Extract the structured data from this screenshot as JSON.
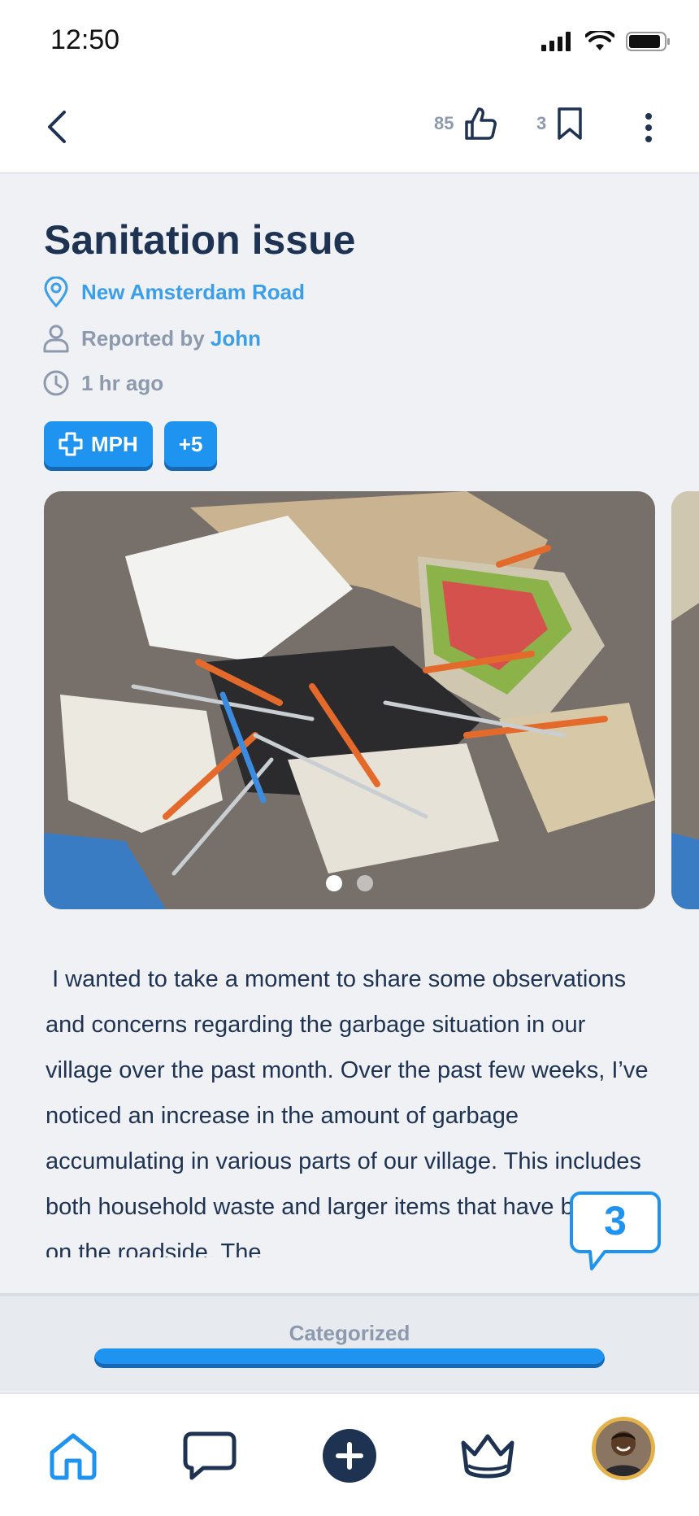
{
  "status_bar": {
    "time": "12:50"
  },
  "header": {
    "likes_count": "85",
    "bookmarks_count": "3"
  },
  "issue": {
    "title": "Sanitation issue",
    "location": "New Amsterdam Road",
    "reported_by_prefix": "Reported by",
    "reporter": "John",
    "time_ago": "1 hr ago",
    "tags": [
      {
        "label": "MPH",
        "icon": "plus-cross-icon"
      },
      {
        "label": "+5"
      }
    ],
    "images_count": 2,
    "active_image_index": 0,
    "description": " I wanted to take a moment to share some observations and concerns regarding the garbage situation in our village over the past month. Over the past few weeks, I’ve noticed an increase in the amount of garbage accumulating in various parts of our village. This includes both household waste and larger items that have been left on the roadside. The"
  },
  "comments": {
    "count": "3"
  },
  "progress": {
    "label": "Categorized",
    "value": 1.0
  },
  "nav": {
    "items": [
      "home-icon",
      "chat-icon",
      "add-icon",
      "crown-icon",
      "avatar"
    ]
  },
  "colors": {
    "accent": "#1f93f0",
    "text_dark": "#1e3252",
    "muted": "#8d9aae",
    "background": "#eff1f4"
  }
}
